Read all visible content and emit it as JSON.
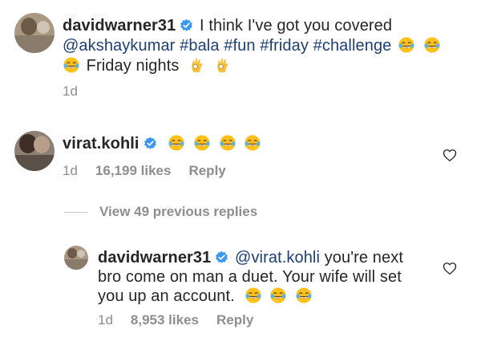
{
  "post": {
    "username": "davidwarner31",
    "text_1": "I think I've got you covered",
    "mention": "@akshaykumar",
    "hashtags": [
      "#bala",
      "#fun",
      "#friday",
      "#challenge"
    ],
    "text_2": "Friday nights",
    "time": "1d",
    "verified": true
  },
  "comments": [
    {
      "username": "virat.kohli",
      "verified": true,
      "emojis": [
        "tears-of-joy",
        "tears-of-joy",
        "tears-of-joy",
        "tears-of-joy"
      ],
      "time": "1d",
      "likes": "16,199 likes",
      "reply_label": "Reply",
      "view_replies_label": "View 49 previous replies"
    },
    {
      "username": "davidwarner31",
      "verified": true,
      "mention": "@virat.kohli",
      "text_1": "you're next",
      "text_2": "bro come on man a duet. Your wife will set",
      "text_3": "you up an account.",
      "emojis": [
        "tears-of-joy",
        "tears-of-joy",
        "tears-of-joy"
      ],
      "time": "1d",
      "likes": "8,953 likes",
      "reply_label": "Reply"
    }
  ],
  "icons": {
    "verified": "verified-badge-icon",
    "like": "heart-icon",
    "emoji": "tears-of-joy",
    "emoji_ok": "ok-hand"
  },
  "colors": {
    "text": "#262626",
    "link": "#1e3f74",
    "meta": "#8e8e8e",
    "verified": "#3897f0",
    "emoji_face": "#fcc21b"
  }
}
